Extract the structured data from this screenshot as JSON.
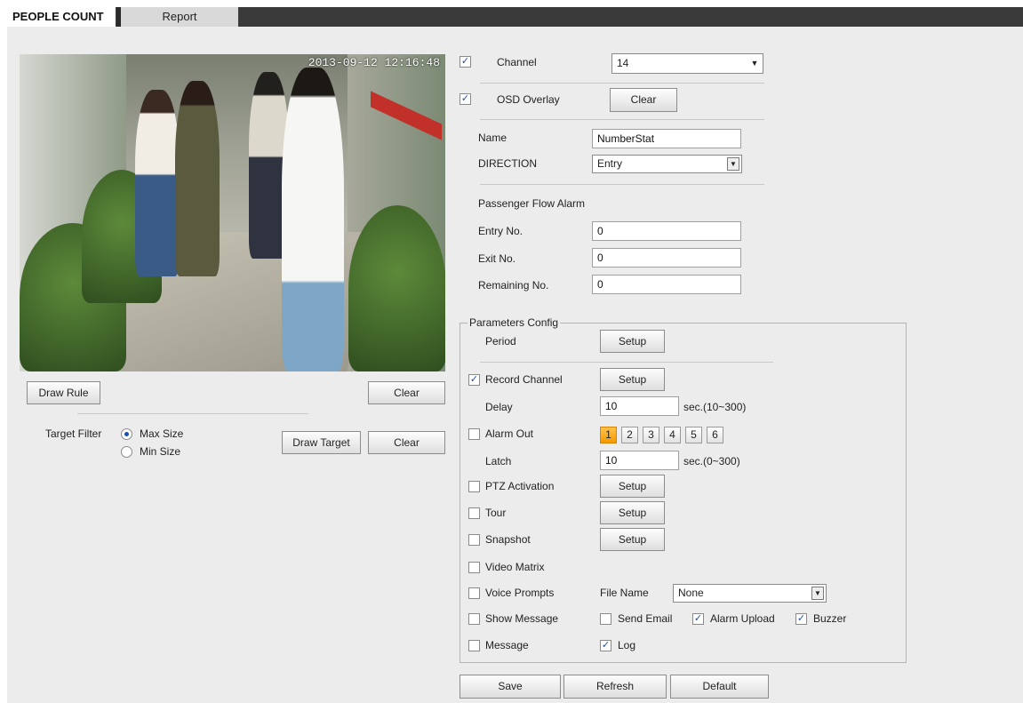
{
  "tabs": {
    "active": "PEOPLE COUNT",
    "inactive": "Report"
  },
  "video": {
    "timestamp": "2013-09-12 12:16:48"
  },
  "left": {
    "draw_rule": "Draw Rule",
    "clear": "Clear",
    "target_filter_label": "Target Filter",
    "max_size": "Max Size",
    "min_size": "Min Size",
    "draw_target": "Draw Target",
    "clear2": "Clear"
  },
  "channel": {
    "label": "Channel",
    "value": "14",
    "checked": true
  },
  "osd": {
    "label": "OSD Overlay",
    "clear": "Clear",
    "checked": true
  },
  "name": {
    "label": "Name",
    "value": "NumberStat"
  },
  "direction": {
    "label": "DIRECTION",
    "value": "Entry"
  },
  "passenger_flow_alarm": "Passenger Flow Alarm",
  "entry_no": {
    "label": "Entry No.",
    "value": "0"
  },
  "exit_no": {
    "label": "Exit No.",
    "value": "0"
  },
  "remaining_no": {
    "label": "Remaining No.",
    "value": "0"
  },
  "params": {
    "legend": "Parameters Config",
    "period": {
      "label": "Period",
      "button": "Setup"
    },
    "record_channel": {
      "label": "Record Channel",
      "button": "Setup",
      "checked": true
    },
    "delay": {
      "label": "Delay",
      "value": "10",
      "unit": "sec.(10~300)"
    },
    "alarm_out": {
      "label": "Alarm Out",
      "channels": [
        "1",
        "2",
        "3",
        "4",
        "5",
        "6"
      ],
      "selected": "1",
      "checked": false
    },
    "latch": {
      "label": "Latch",
      "value": "10",
      "unit": "sec.(0~300)"
    },
    "ptz_activation": {
      "label": "PTZ Activation",
      "button": "Setup"
    },
    "tour": {
      "label": "Tour",
      "button": "Setup"
    },
    "snapshot": {
      "label": "Snapshot",
      "button": "Setup"
    },
    "video_matrix": {
      "label": "Video Matrix"
    },
    "voice_prompts": {
      "label": "Voice Prompts",
      "file_name_label": "File Name",
      "file_name_value": "None"
    },
    "show_message": {
      "label": "Show Message"
    },
    "send_email": {
      "label": "Send Email",
      "checked": false
    },
    "alarm_upload": {
      "label": "Alarm Upload",
      "checked": true
    },
    "buzzer": {
      "label": "Buzzer",
      "checked": true
    },
    "message": {
      "label": "Message"
    },
    "log": {
      "label": "Log",
      "checked": true
    }
  },
  "footer": {
    "save": "Save",
    "refresh": "Refresh",
    "default": "Default"
  },
  "colors": {
    "accent_selected": "#f49a00",
    "header": "#3a3a3a"
  }
}
